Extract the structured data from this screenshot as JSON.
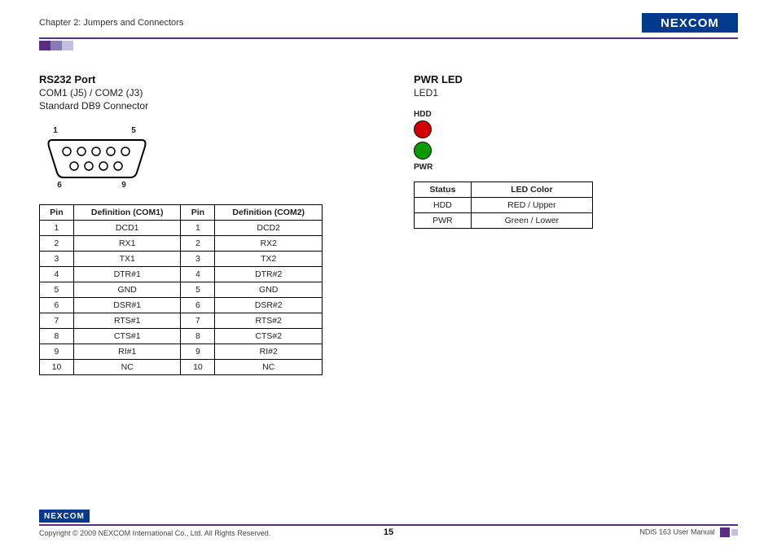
{
  "header": {
    "chapter": "Chapter 2: Jumpers and Connectors",
    "logo_text": "NEXCOM"
  },
  "left": {
    "title": "RS232 Port",
    "sub1": "COM1 (J5) / COM2 (J3)",
    "sub2": "Standard DB9 Connector",
    "pin_labels": {
      "tl": "1",
      "tr": "5",
      "bl": "6",
      "br": "9"
    },
    "table_headers": [
      "Pin",
      "Definition (COM1)",
      "Pin",
      "Definition (COM2)"
    ],
    "rows": [
      [
        "1",
        "DCD1",
        "1",
        "DCD2"
      ],
      [
        "2",
        "RX1",
        "2",
        "RX2"
      ],
      [
        "3",
        "TX1",
        "3",
        "TX2"
      ],
      [
        "4",
        "DTR#1",
        "4",
        "DTR#2"
      ],
      [
        "5",
        "GND",
        "5",
        "GND"
      ],
      [
        "6",
        "DSR#1",
        "6",
        "DSR#2"
      ],
      [
        "7",
        "RTS#1",
        "7",
        "RTS#2"
      ],
      [
        "8",
        "CTS#1",
        "8",
        "CTS#2"
      ],
      [
        "9",
        "RI#1",
        "9",
        "RI#2"
      ],
      [
        "10",
        "NC",
        "10",
        "NC"
      ]
    ]
  },
  "right": {
    "title": "PWR LED",
    "sub": "LED1",
    "hdd_label": "HDD",
    "pwr_label": "PWR",
    "table_headers": [
      "Status",
      "LED Color"
    ],
    "rows": [
      [
        "HDD",
        "RED / Upper"
      ],
      [
        "PWR",
        "Green / Lower"
      ]
    ]
  },
  "footer": {
    "copyright": "Copyright © 2009 NEXCOM International Co., Ltd. All Rights Reserved.",
    "page": "15",
    "manual": "NDiS 163 User Manual",
    "logo_text": "NEXCOM"
  }
}
